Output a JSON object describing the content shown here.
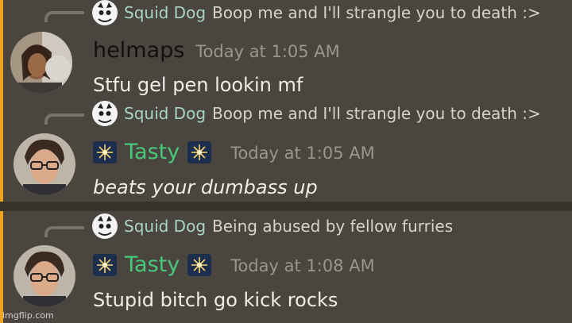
{
  "messages": [
    {
      "reply": {
        "author": "Squid Dog",
        "text": "Boop me and I'll strangle you to death :>"
      },
      "author": "helmaps",
      "timestamp": "Today at 1:05 AM",
      "body": "Stfu gel pen lookin mf"
    },
    {
      "reply": {
        "author": "Squid Dog",
        "text": "Boop me and I'll strangle you to death :>"
      },
      "author": "Tasty",
      "timestamp": "Today at 1:05 AM",
      "body": "beats your dumbass up"
    },
    {
      "reply": {
        "author": "Squid Dog",
        "text": "Being abused by fellow furries"
      },
      "author": "Tasty",
      "timestamp": "Today at 1:08 AM",
      "body": "Stupid bitch go kick rocks"
    }
  ],
  "icons": {
    "reply_avatar": "squid-dog-avatar-icon",
    "author_emoji": "sparkler-emoji-icon"
  },
  "colors": {
    "highlight_bar": "#f0a51a",
    "tasty_name": "#48c87a",
    "reply_name": "#a9d4c6",
    "panel_bg": "#4a453e"
  },
  "watermark": "imgflip.com"
}
